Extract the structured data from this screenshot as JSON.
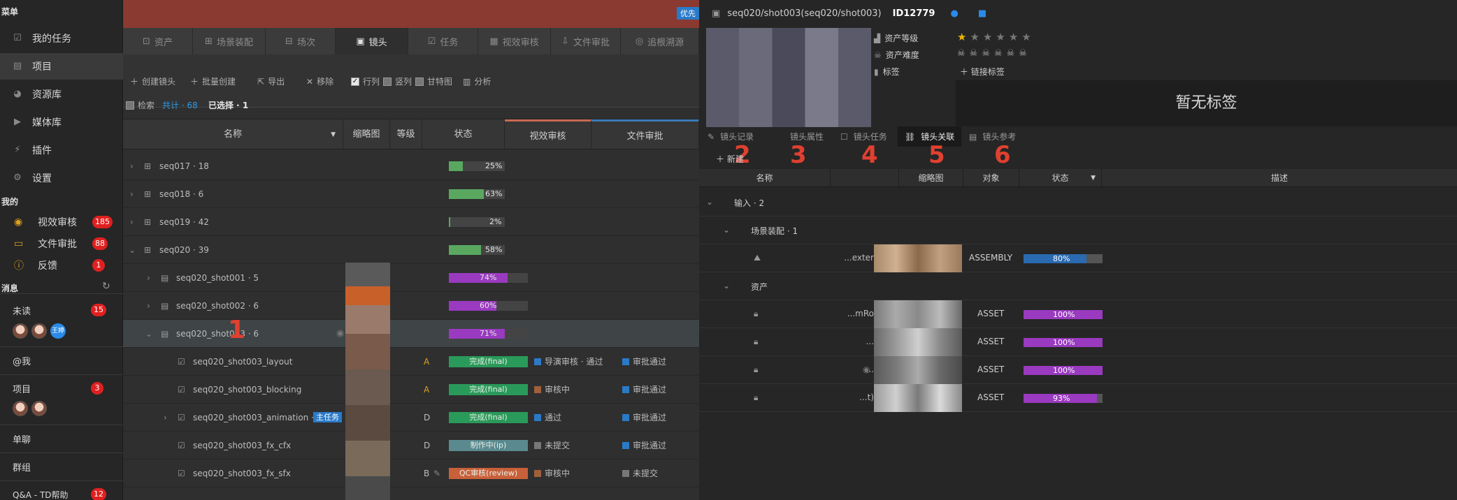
{
  "sidebar": {
    "menu_title": "菜单",
    "items": [
      {
        "label": "我的任务",
        "icon": "checkbox-icon"
      },
      {
        "label": "项目",
        "icon": "folder-icon"
      },
      {
        "label": "资源库",
        "icon": "globe-icon"
      },
      {
        "label": "媒体库",
        "icon": "media-icon"
      },
      {
        "label": "插件",
        "icon": "plug-icon"
      },
      {
        "label": "设置",
        "icon": "gear-icon"
      }
    ],
    "mine_title": "我的",
    "mine": [
      {
        "label": "视效审核",
        "count": "185"
      },
      {
        "label": "文件审批",
        "count": "88"
      },
      {
        "label": "反馈",
        "count": "1"
      }
    ],
    "msg_title": "消息",
    "unread_label": "未读",
    "unread_count": "15",
    "avatar_name": "王婷",
    "at_me_label": "@我",
    "project_label": "项目",
    "project_count": "3",
    "single_chat_label": "单聊",
    "group_label": "群组",
    "qa_label": "Q&A - TD帮助",
    "qa_count": "12"
  },
  "mid": {
    "topbar_badge": "优先",
    "tabs": [
      "资产",
      "场景装配",
      "场次",
      "镜头",
      "任务",
      "视效审核",
      "文件审批",
      "追根溯源"
    ],
    "toolbar": {
      "create": "创建镜头",
      "batch_create": "批量创建",
      "export": "导出",
      "remove": "移除",
      "row_col": "行列",
      "col": "竖列",
      "gantt": "甘特图",
      "analyze": "分析",
      "search": "检索",
      "total": "共计 · 68",
      "selected": "已选择 · 1"
    },
    "columns": [
      "名称",
      "缩略图",
      "等级",
      "状态",
      "视效审核",
      "文件审批"
    ],
    "rows": [
      {
        "name": "seq017 · 18",
        "progress": 25,
        "progress_label": "25%"
      },
      {
        "name": "seq018 · 6",
        "progress": 63,
        "progress_label": "63%"
      },
      {
        "name": "seq019 · 42",
        "progress": 2,
        "progress_label": "2%"
      },
      {
        "name": "seq020 · 39",
        "progress": 58,
        "progress_label": "58%"
      },
      {
        "name": "seq020_shot001 · 5",
        "progress": 74,
        "progress_label": "74%"
      },
      {
        "name": "seq020_shot002 · 6",
        "progress": 60,
        "progress_label": "60%"
      },
      {
        "name": "seq020_shot003 · 6",
        "progress": 71,
        "progress_label": "71%"
      },
      {
        "name": "seq020_shot003_layout",
        "grade": "A",
        "status": "完成(final)",
        "vfx": "导演审核 · 通过",
        "file": "审批通过"
      },
      {
        "name": "seq020_shot003_blocking",
        "grade": "A",
        "status": "完成(final)",
        "vfx": "审核中",
        "file": "审批通过"
      },
      {
        "name": "seq020_shot003_animation · 1",
        "tag": "主任务",
        "grade": "D",
        "status": "完成(final)",
        "vfx": "通过",
        "file": "审批通过"
      },
      {
        "name": "seq020_shot003_fx_cfx",
        "grade": "D",
        "status": "制作中(ip)",
        "vfx": "未提交",
        "file": "审批通过"
      },
      {
        "name": "seq020_shot003_fx_sfx",
        "grade": "B",
        "status": "QC审核(review)",
        "vfx": "审核中",
        "file": "未提交"
      }
    ],
    "annotation_1": "1"
  },
  "right": {
    "path": "seq020/shot003(seq020/shot003)",
    "id": "ID12779",
    "asset_level_label": "资产等级",
    "asset_difficulty_label": "资产难度",
    "tag_label": "标签",
    "link_tag_label": "链接标签",
    "rating": 1,
    "rating_max": 6,
    "difficulty_count": 6,
    "no_tag": "暂无标签",
    "tabs": [
      "镜头记录",
      "镜头属性",
      "镜头任务",
      "镜头关联",
      "镜头参考"
    ],
    "annotations": [
      "2",
      "3",
      "4",
      "5",
      "6"
    ],
    "add_label": "新建",
    "columns": [
      "名称",
      "缩略图",
      "对象",
      "状态",
      "描述"
    ],
    "group_input": "输入 · 2",
    "group_scene": "场景装配 · 1",
    "group_asset": "资产",
    "items": [
      {
        "name": "...exter",
        "object": "ASSEMBLY",
        "progress": 80,
        "label": "80%",
        "color": "#2a6ab0"
      },
      {
        "name": "...mRo",
        "object": "ASSET",
        "progress": 100,
        "label": "100%",
        "color": "#9a3ac0"
      },
      {
        "name": "...",
        "object": "ASSET",
        "progress": 100,
        "label": "100%",
        "color": "#9a3ac0"
      },
      {
        "name": "...",
        "object": "ASSET",
        "progress": 100,
        "label": "100%",
        "color": "#9a3ac0"
      },
      {
        "name": "...t)",
        "object": "ASSET",
        "progress": 93,
        "label": "93%",
        "color": "#9a3ac0"
      }
    ]
  }
}
